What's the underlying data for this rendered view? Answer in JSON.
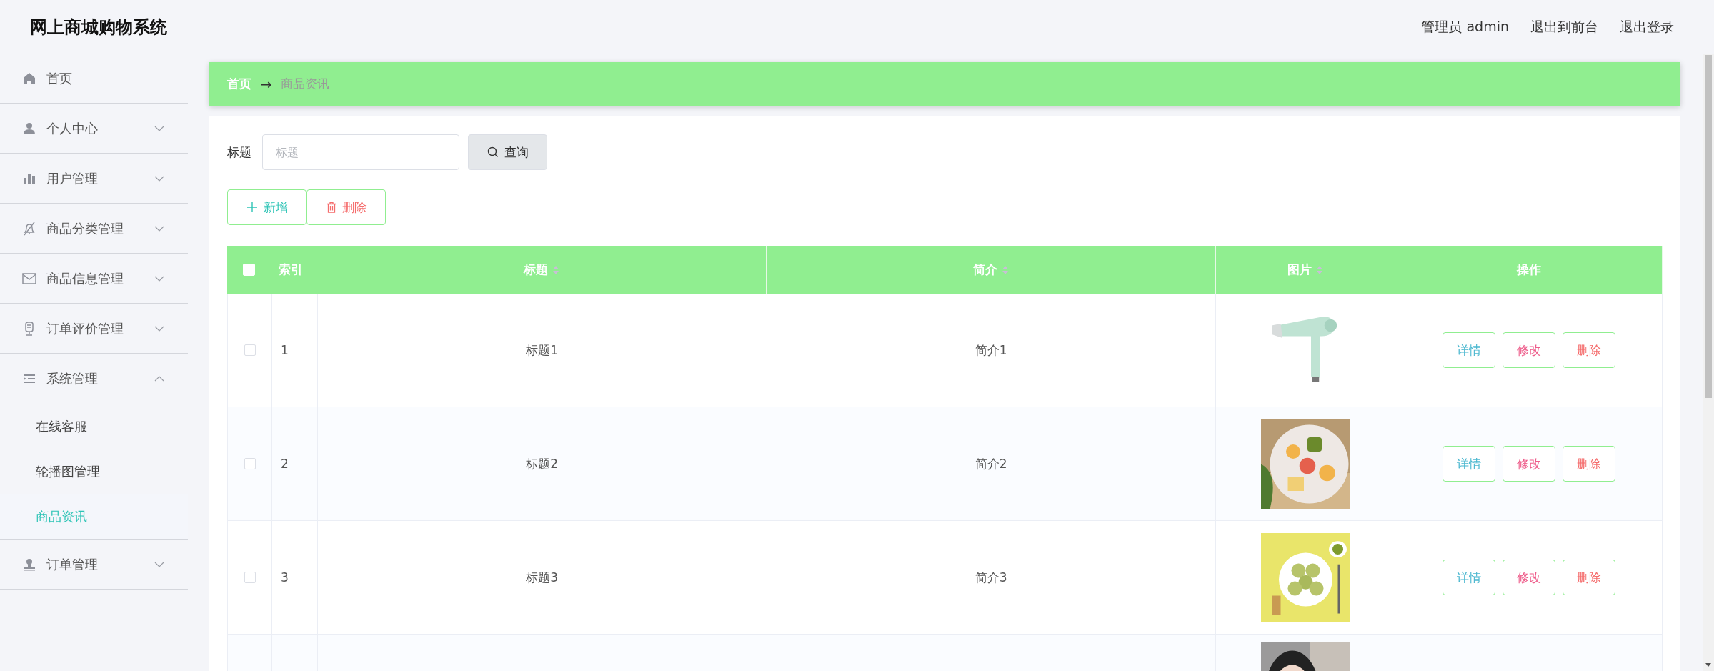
{
  "app": {
    "title": "网上商城购物系统"
  },
  "header": {
    "user": "管理员 admin",
    "links": [
      "退出到前台",
      "退出登录"
    ]
  },
  "sidebar": {
    "items": [
      {
        "kind": "link",
        "label": "首页"
      },
      {
        "kind": "menu",
        "label": "个人中心",
        "expanded": false
      },
      {
        "kind": "menu",
        "label": "用户管理",
        "expanded": false
      },
      {
        "kind": "menu",
        "label": "商品分类管理",
        "expanded": false
      },
      {
        "kind": "menu",
        "label": "商品信息管理",
        "expanded": false
      },
      {
        "kind": "menu",
        "label": "订单评价管理",
        "expanded": false
      },
      {
        "kind": "menu",
        "label": "系统管理",
        "expanded": true,
        "children": [
          {
            "label": "在线客服",
            "selected": false
          },
          {
            "label": "轮播图管理",
            "selected": false
          },
          {
            "label": "商品资讯",
            "selected": true
          }
        ]
      },
      {
        "kind": "menu",
        "label": "订单管理",
        "expanded": false
      }
    ]
  },
  "breadcrumb": {
    "items": [
      "首页",
      "商品资讯"
    ],
    "separator": "→"
  },
  "search": {
    "label": "标题",
    "placeholder": "标题",
    "button": "查询"
  },
  "actions": [
    {
      "kind": "add",
      "label": "新增"
    },
    {
      "kind": "delete",
      "label": "删除"
    }
  ],
  "table": {
    "columns": [
      {
        "kind": "check",
        "checked": false
      },
      {
        "kind": "text",
        "label": "索引",
        "sortable": false
      },
      {
        "kind": "text",
        "label": "标题",
        "sortable": true
      },
      {
        "kind": "text",
        "label": "简介",
        "sortable": true
      },
      {
        "kind": "text",
        "label": "图片",
        "sortable": true
      },
      {
        "kind": "text",
        "label": "操作",
        "sortable": false
      }
    ],
    "rows": [
      {
        "checked": false,
        "index": "1",
        "title": "标题1",
        "intro": "简介1",
        "image": {
          "kind": "picture"
        },
        "actions": [
          {
            "kind": "detail",
            "label": "详情"
          },
          {
            "kind": "edit",
            "label": "修改"
          },
          {
            "kind": "delete",
            "label": "删除"
          }
        ]
      },
      {
        "checked": false,
        "index": "2",
        "title": "标题2",
        "intro": "简介2",
        "image": {
          "kind": "picture"
        },
        "actions": [
          {
            "kind": "detail",
            "label": "详情"
          },
          {
            "kind": "edit",
            "label": "修改"
          },
          {
            "kind": "delete",
            "label": "删除"
          }
        ]
      },
      {
        "checked": false,
        "index": "3",
        "title": "标题3",
        "intro": "简介3",
        "image": {
          "kind": "picture"
        },
        "actions": [
          {
            "kind": "detail",
            "label": "详情"
          },
          {
            "kind": "edit",
            "label": "修改"
          },
          {
            "kind": "delete",
            "label": "删除"
          }
        ]
      },
      {
        "image": {
          "kind": "picture"
        }
      }
    ]
  }
}
